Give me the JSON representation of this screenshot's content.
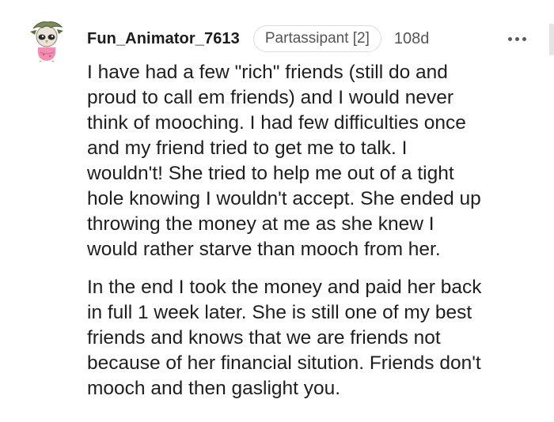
{
  "comment": {
    "author": "Fun_Animator_7613",
    "flair": "Partassipant [2]",
    "age": "108d",
    "more_icon": "ellipsis-horizontal",
    "paragraphs": [
      {
        "lines": [
          "I have had a few \"rich\" friends (still do and",
          "proud to call em friends) and I would never",
          "think of mooching. I had few difficulties once",
          "and my friend tried to get me to talk. I",
          "wouldn't! She tried to help me out of a tight",
          "hole knowing I wouldn't accept. She ended up",
          "throwing the money at me as she knew I",
          "would rather starve than mooch from her."
        ]
      },
      {
        "lines": [
          "In the end I took the money and paid her back",
          "in full 1 week later. She is still one of my best",
          "friends and knows that we are friends not",
          "because of her financial sitution. Friends don't",
          "mooch and then gaslight you."
        ]
      }
    ]
  }
}
